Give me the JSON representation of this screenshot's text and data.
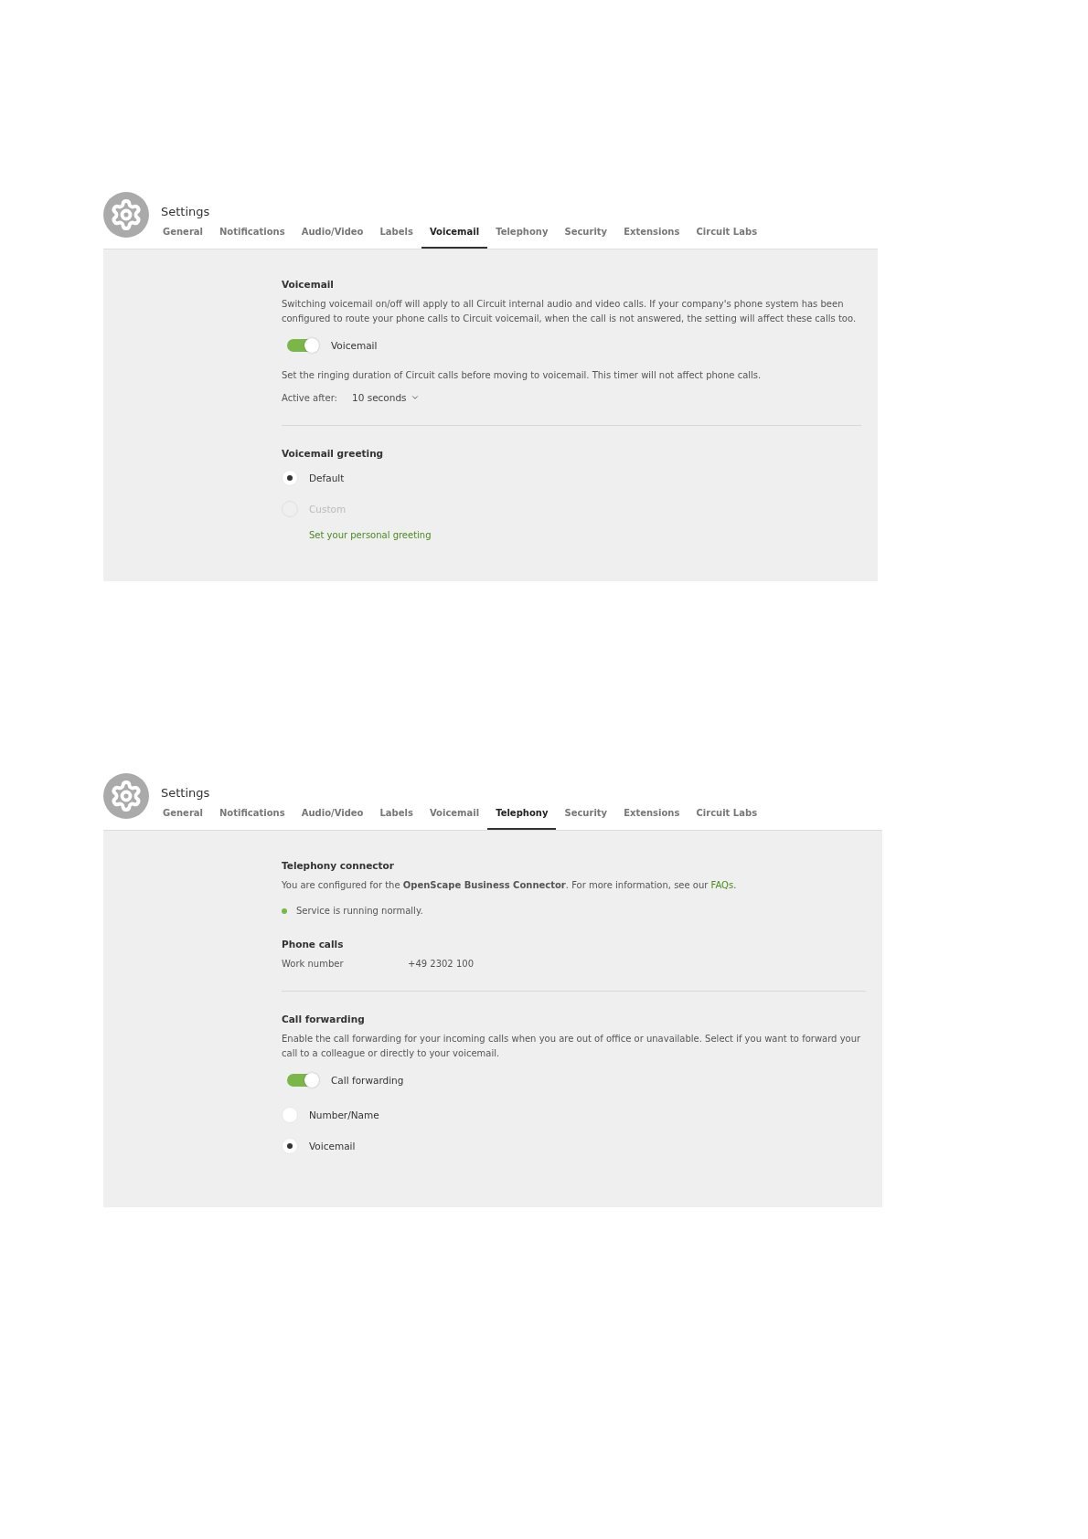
{
  "panels": [
    {
      "title": "Settings",
      "tabs": [
        {
          "label": "General",
          "selected": false
        },
        {
          "label": "Notifications",
          "selected": false
        },
        {
          "label": "Audio/Video",
          "selected": false
        },
        {
          "label": "Labels",
          "selected": false
        },
        {
          "label": "Voicemail",
          "selected": true
        },
        {
          "label": "Telephony",
          "selected": false
        },
        {
          "label": "Security",
          "selected": false
        },
        {
          "label": "Extensions",
          "selected": false
        },
        {
          "label": "Circuit Labs",
          "selected": false
        }
      ],
      "sections": [
        {
          "title": "Voicemail",
          "items": [
            {
              "kind": "text",
              "text": "Switching voicemail on/off will apply to all Circuit internal audio and video calls. If your company's phone system has been configured to route your phone calls to Circuit voicemail, when the call is not answered, the setting will affect these calls too."
            },
            {
              "kind": "toggle",
              "label": "Voicemail",
              "on": true
            },
            {
              "kind": "text",
              "text": "Set the ringing duration of Circuit calls before moving to voicemail. This timer will not affect phone calls."
            },
            {
              "kind": "select",
              "label": "Active after:",
              "value": "10 seconds"
            }
          ]
        },
        {
          "title": "Voicemail greeting",
          "items": [
            {
              "kind": "radio",
              "label": "Default",
              "selected": true,
              "disabled": false
            },
            {
              "kind": "radio",
              "label": "Custom",
              "selected": false,
              "disabled": true
            },
            {
              "kind": "link",
              "text": "Set your personal greeting"
            }
          ]
        }
      ]
    },
    {
      "title": "Settings",
      "tabs": [
        {
          "label": "General",
          "selected": false
        },
        {
          "label": "Notifications",
          "selected": false
        },
        {
          "label": "Audio/Video",
          "selected": false
        },
        {
          "label": "Labels",
          "selected": false
        },
        {
          "label": "Voicemail",
          "selected": false
        },
        {
          "label": "Telephony",
          "selected": true
        },
        {
          "label": "Security",
          "selected": false
        },
        {
          "label": "Extensions",
          "selected": false
        },
        {
          "label": "Circuit Labs",
          "selected": false
        }
      ],
      "sections": [
        {
          "title": "Telephony connector",
          "items": [
            {
              "kind": "text-link",
              "text": "You are configured for the **OpenScape Business Connector**. For more information, see our",
              "link": "FAQs",
              "after": "."
            },
            {
              "kind": "status",
              "text": "Service is running normally.",
              "color": "#7ab648"
            },
            {
              "kind": "subheading",
              "title": "Phone calls"
            },
            {
              "kind": "field",
              "label": "Work number",
              "value": "+49 2302 100"
            }
          ]
        },
        {
          "title": "Call forwarding",
          "items": [
            {
              "kind": "text",
              "text": "Enable the call forwarding for your incoming calls when you are out of office or unavailable. Select if you want to forward your call to a colleague or directly to your voicemail."
            },
            {
              "kind": "toggle",
              "label": "Call forwarding",
              "on": true
            },
            {
              "kind": "radio",
              "label": "Number/Name",
              "selected": false,
              "disabled": false
            },
            {
              "kind": "radio",
              "label": "Voicemail",
              "selected": true,
              "disabled": false
            }
          ]
        }
      ]
    }
  ]
}
